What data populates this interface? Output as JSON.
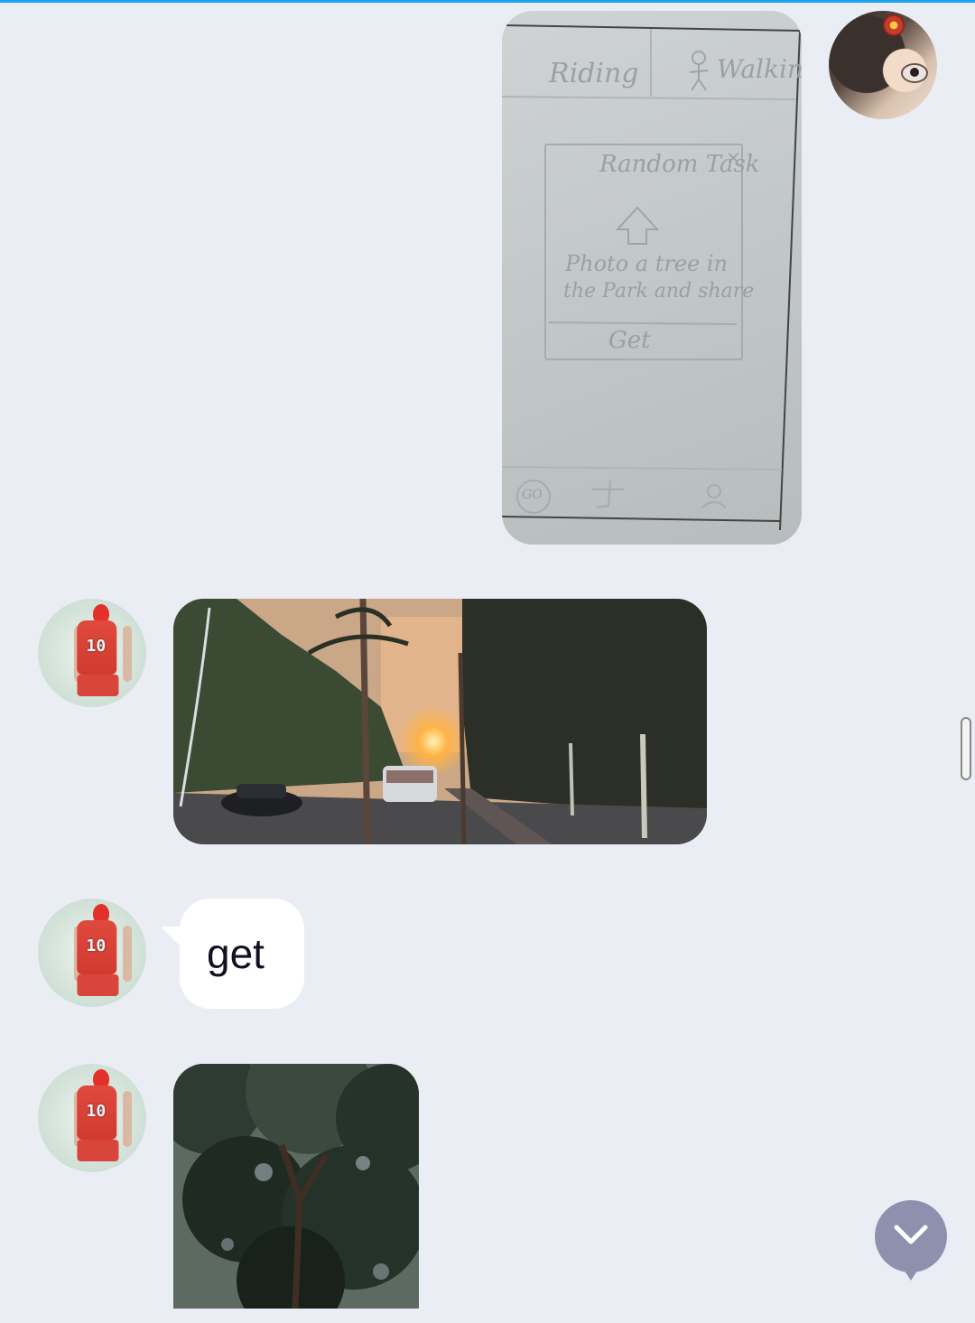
{
  "chat": {
    "messages": [
      {
        "sender": "me",
        "type": "image",
        "image_desc_icon": "sketch-image"
      },
      {
        "sender": "other",
        "type": "image",
        "image_desc_icon": "sunset-road-image"
      },
      {
        "sender": "other",
        "type": "text",
        "text": "get"
      },
      {
        "sender": "other",
        "type": "image",
        "image_desc_icon": "trees-image"
      }
    ]
  },
  "sketch": {
    "tab_left": "Riding",
    "tab_right": "Walking",
    "dialog_title": "Random Task",
    "dialog_close": "×",
    "dialog_body_line1": "Photo a tree in",
    "dialog_body_line2": "the Park and share",
    "dialog_button": "Get",
    "bottom_nav_go": "GO"
  },
  "colors": {
    "background": "#ebedf5",
    "bubble": "#ffffff",
    "accent_line": "#1aa1f0",
    "scroll_button": "#8e91ad"
  }
}
